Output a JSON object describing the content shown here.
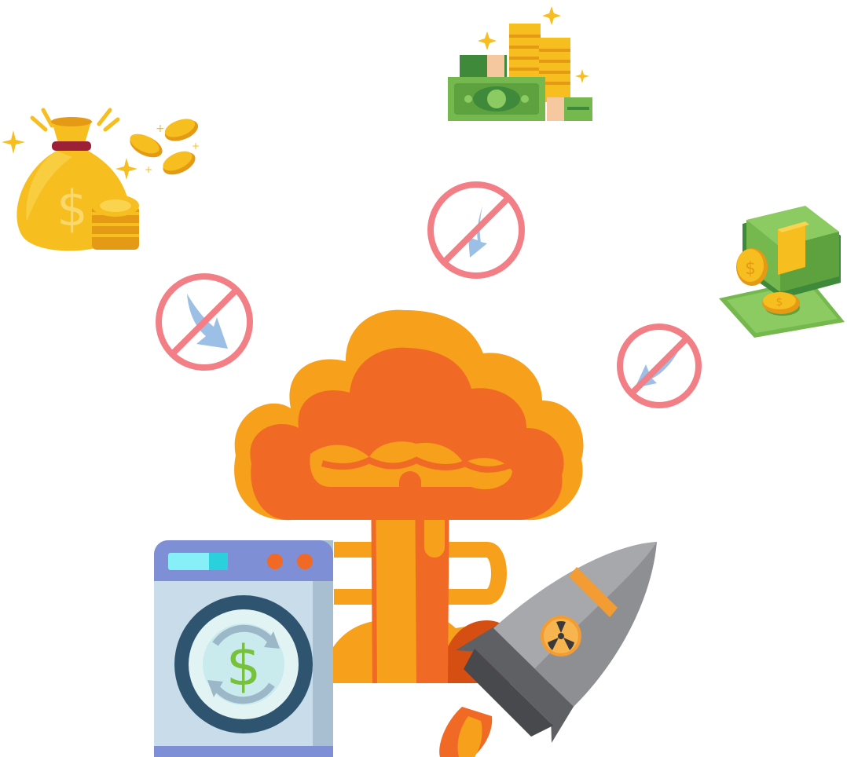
{
  "scene": {
    "icons": [
      "money-bag-icon",
      "cash-stack-icon",
      "banknotes-icon",
      "mushroom-cloud-icon",
      "washing-machine-icon",
      "nuclear-missile-icon",
      "prohibited-flow-icon"
    ],
    "money_symbol": "$",
    "colors": {
      "background": "#ffffff",
      "gold": "#F6BE1E",
      "gold_dark": "#E59A16",
      "cash_green": "#74B84E",
      "explosion_orange": "#F06A25",
      "explosion_yellow": "#F6A01C",
      "prohibit_red": "#F37F86",
      "arrow_blue": "#9CBFE6",
      "machine_gray": "#C9DCEA",
      "machine_panel": "#7E8FD6",
      "missile_gray": "#7E7F83",
      "radiation_orange": "#F39C32"
    }
  }
}
